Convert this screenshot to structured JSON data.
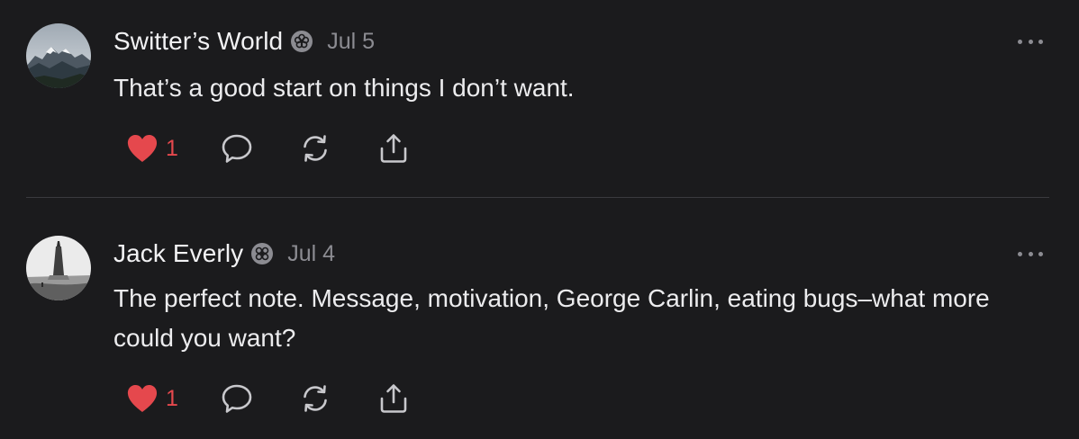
{
  "comments": [
    {
      "author": "Switter’s World",
      "date": "Jul 5",
      "text": "That’s a good start on things I don’t want.",
      "likes": "1"
    },
    {
      "author": "Jack Everly",
      "date": "Jul 4",
      "text": "The perfect note. Message, motivation, George Carlin, eating bugs–what more could you want?",
      "likes": "1"
    }
  ],
  "colors": {
    "background": "#1b1b1d",
    "text": "#ececee",
    "muted": "#8c8c92",
    "like_red": "#e5484d",
    "divider": "#3a3a3e"
  },
  "icons": {
    "like": "heart-icon",
    "reply": "speech-bubble-icon",
    "restack": "restack-arrows-icon",
    "share": "share-upload-icon",
    "more": "ellipsis-icon",
    "badge": "flower-badge-icon"
  }
}
